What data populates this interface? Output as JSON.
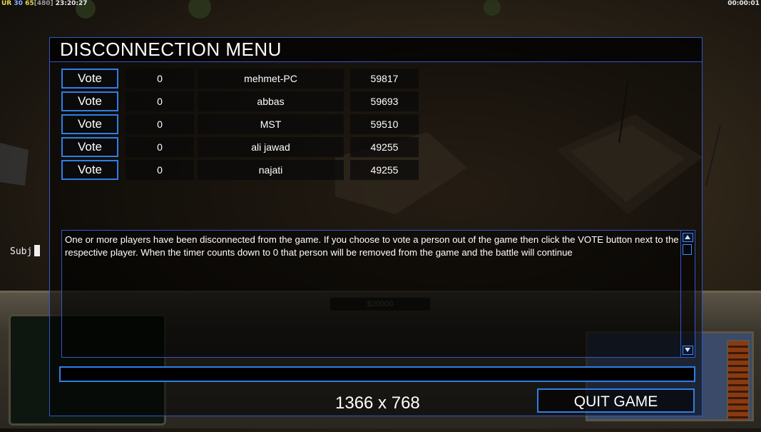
{
  "hud": {
    "stats_ur": "UR",
    "stats_a": "30",
    "stats_b": "65",
    "stats_c": "[480]",
    "clock": "23:20:27",
    "timer": "00:00:01"
  },
  "side_label": "Subj",
  "bottom_panel": {
    "cash": "$20000"
  },
  "dialog": {
    "title": "DISCONNECTION MENU",
    "vote_label": "Vote",
    "players": [
      {
        "votes": "0",
        "name": "mehmet-PC",
        "ping": "59817"
      },
      {
        "votes": "0",
        "name": "abbas",
        "ping": "59693"
      },
      {
        "votes": "0",
        "name": "MST",
        "ping": "59510"
      },
      {
        "votes": "0",
        "name": "ali jawad",
        "ping": "49255"
      },
      {
        "votes": "0",
        "name": "najati",
        "ping": "49255"
      }
    ],
    "message": "One or more players have been disconnected from the game. If you choose to vote a person out of the game then click the VOTE button next to the respective player. When the timer counts down to 0 that person will be removed from the game and the battle will continue",
    "chat_value": "",
    "resolution": "1366 x 768",
    "quit_label": "QUIT GAME"
  },
  "colors": {
    "accent_border": "#2f7de8",
    "frame_border": "#3456c8",
    "text": "#ffffff"
  }
}
